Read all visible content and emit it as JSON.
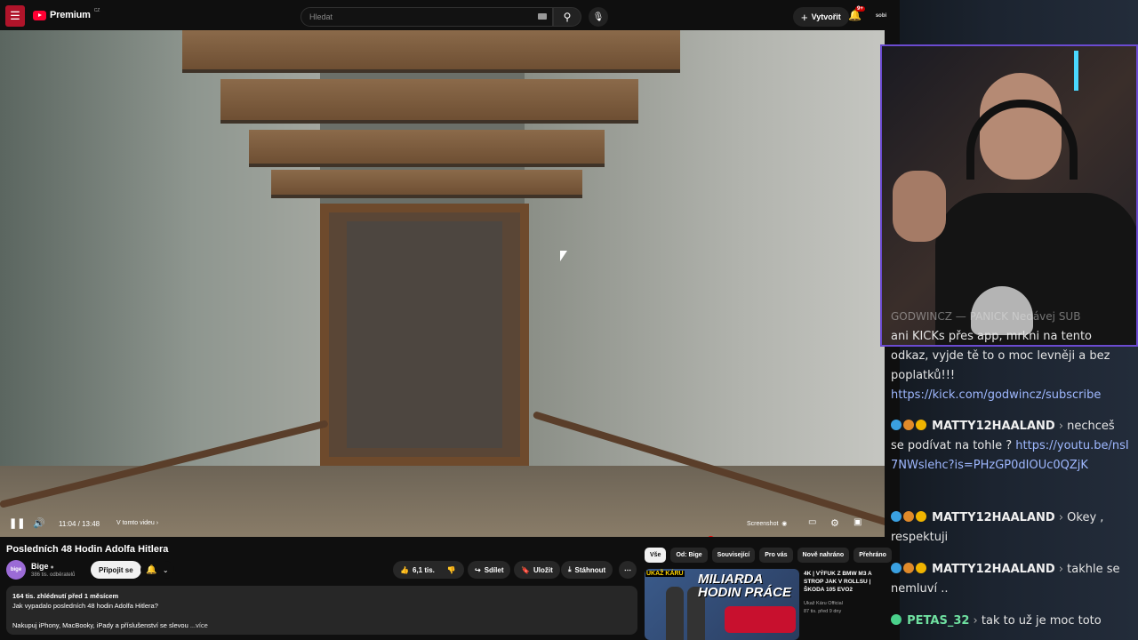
{
  "header": {
    "logo_text": "Premium",
    "logo_country": "CZ",
    "search_placeholder": "Hledat",
    "create_label": "Vytvořit",
    "notification_count": "9+",
    "avatar_text": "sobi"
  },
  "player": {
    "time": "11:04 / 13:48",
    "chapter": "V tomto videu",
    "screenshot_label": "Screenshot",
    "progress_fraction": 0.8027
  },
  "video": {
    "title": "Posledních 48 Hodin Adolfa Hitlera",
    "channel_name": "Bige",
    "channel_avatar": "bige",
    "subscribers": "386 tis. odběratelů",
    "join_label": "Připojit se",
    "likes": "6,1 tis.",
    "share_label": "Sdílet",
    "save_label": "Uložit",
    "download_label": "Stáhnout",
    "views_date": "164 tis. zhlédnutí  před 1 měsícem",
    "desc_line1": "Jak vypadalo posledních 48 hodin Adolfa Hitlera?",
    "desc_line2": "Nakupuj iPhony, MacBooky, iPady a příslušenství se slevou",
    "desc_more": "...více"
  },
  "chips": [
    "Vše",
    "Od: Bige",
    "Související",
    "Pro vás",
    "Nově nahráno",
    "Přehráno"
  ],
  "recommendation": {
    "thumb_text": "MILIARDA HODIN PRÁCE",
    "thumb_label": "UKAŽ KÁRU",
    "title": "4K | VÝFUK Z BMW M3 A STROP JAK V ROLLSU | ŠKODA 105 EVO2",
    "channel": "Ukaž Káru Official",
    "meta": "87 tis.  před 9 dny"
  },
  "chat": {
    "partial1": "GODWINCZ — PANICK  Nedávej SUB",
    "partial2": "ani KICKs přes app, mrkni na tento odkaz, vyjde tě to o moc levněji a bez poplatků!!!",
    "partial_link": "https://kick.com/godwincz/subscribe",
    "messages": [
      {
        "user": "MATTY12HAALAND",
        "text": "nechceš se podívat na tohle ?",
        "link": "https://youtu.be/nsI7NWslehc?is=PHzGP0dIOUc0QZjK"
      },
      {
        "user": "MATTY12HAALAND",
        "text": "Okey , respektuji",
        "link": ""
      },
      {
        "user": "MATTY12HAALAND",
        "text": "takhle se nemluví ..",
        "link": ""
      },
      {
        "user": "PETAS_32",
        "text": "tak to už je moc toto",
        "link": ""
      }
    ]
  },
  "colors": {
    "accent": "#ff0000",
    "webcam_border": "#6b4bd0",
    "link": "#9fb8ff"
  }
}
